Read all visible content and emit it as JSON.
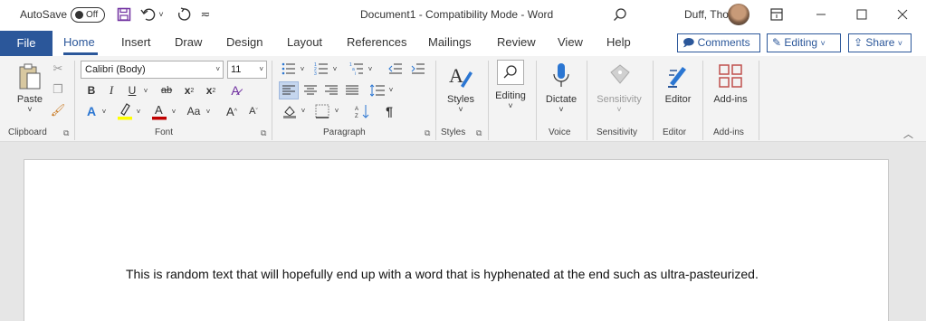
{
  "titlebar": {
    "autosave_label": "AutoSave",
    "autosave_state": "Off",
    "document_title": "Document1  -  Compatibility Mode  -  Word",
    "user_name": "Duff, Thomas"
  },
  "tabs": {
    "file": "File",
    "home": "Home",
    "insert": "Insert",
    "draw": "Draw",
    "design": "Design",
    "layout": "Layout",
    "references": "References",
    "mailings": "Mailings",
    "review": "Review",
    "view": "View",
    "help": "Help",
    "active": "Home"
  },
  "actions": {
    "comments": "Comments",
    "editing_mode": "Editing",
    "share": "Share"
  },
  "ribbon": {
    "clipboard": {
      "paste_label": "Paste",
      "group_label": "Clipboard"
    },
    "font": {
      "font_name": "Calibri (Body)",
      "font_size": "11",
      "bold": "B",
      "italic": "I",
      "underline": "U",
      "strikethrough": "ab",
      "subscript": "x",
      "superscript": "x",
      "change_case": "Aa",
      "grow_font": "A",
      "shrink_font": "A",
      "group_label": "Font"
    },
    "paragraph": {
      "group_label": "Paragraph"
    },
    "styles": {
      "button_label": "Styles",
      "group_label": "Styles"
    },
    "editing": {
      "button_label": "Editing"
    },
    "voice": {
      "button_label": "Dictate",
      "group_label": "Voice"
    },
    "sensitivity": {
      "button_label": "Sensitivity",
      "group_label": "Sensitivity"
    },
    "editor": {
      "button_label": "Editor",
      "group_label": "Editor"
    },
    "addins": {
      "button_label": "Add-ins",
      "group_label": "Add-ins"
    }
  },
  "document": {
    "body_text": "This is random text that will hopefully end up with a word that is hyphenated at the end such as ultra-pasteurized."
  },
  "colors": {
    "brand": "#2b579a",
    "ribbon_bg": "#f3f3f3",
    "canvas_bg": "#e6e6e6",
    "highlight": "#ffff00",
    "font_color": "#c00000"
  }
}
